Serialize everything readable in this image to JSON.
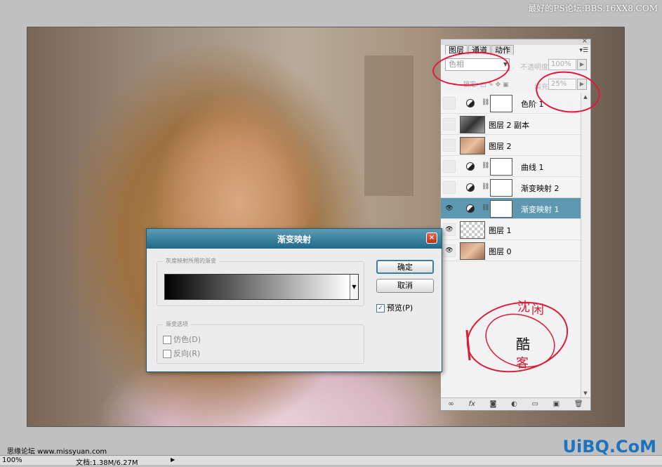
{
  "watermark": "最好的PS论坛:BBS.16XX8.COM",
  "dialog": {
    "title": "渐变映射",
    "close_glyph": "×",
    "gradient_group": "灰度映射所用的渐变",
    "options_group": "渐变选项",
    "ok_label": "确定",
    "cancel_label": "取消",
    "preview_label": "预览(P)",
    "dither_label": "仿色(D)",
    "reverse_label": "反向(R)",
    "preview_checked": true
  },
  "panel": {
    "close_glyph": "×",
    "tabs": [
      "图层",
      "通道",
      "动作"
    ],
    "blend_mode": "色相",
    "opacity_label": "不透明度:",
    "opacity_value": "100%",
    "fill_label": "填充:",
    "fill_value": "25%",
    "lock_label": "锁定:",
    "layers": [
      {
        "name": "色阶 1",
        "visible": false,
        "type": "adjustment",
        "selected": false
      },
      {
        "name": "图层 2 副本",
        "visible": false,
        "type": "image",
        "selected": false
      },
      {
        "name": "图层 2",
        "visible": false,
        "type": "image",
        "selected": false
      },
      {
        "name": "曲线 1",
        "visible": false,
        "type": "adjustment",
        "selected": false
      },
      {
        "name": "渐变映射 2",
        "visible": false,
        "type": "adjustment",
        "selected": false
      },
      {
        "name": "渐变映射 1",
        "visible": true,
        "type": "adjustment",
        "selected": true
      },
      {
        "name": "图层 1",
        "visible": true,
        "type": "transparent",
        "selected": false
      },
      {
        "name": "图层 0",
        "visible": true,
        "type": "image",
        "selected": false
      }
    ],
    "footer_icons": [
      "link-icon",
      "fx",
      "mask-icon",
      "adjust-icon",
      "folder-icon",
      "new-layer-icon",
      "trash-icon"
    ]
  },
  "stamp": {
    "line1": "沈",
    "line2": "闲",
    "line3": "酷",
    "line4": "客"
  },
  "status": {
    "zoom": "100%",
    "doc": "文档:1.38M/6.27M",
    "site": "思缘论坛 www.missyuan.com"
  },
  "logo": "UiBQ.CoM",
  "colors": {
    "accent": "#1f6a89",
    "selected_layer": "#5e97b0",
    "annotation": "#e8143c"
  }
}
